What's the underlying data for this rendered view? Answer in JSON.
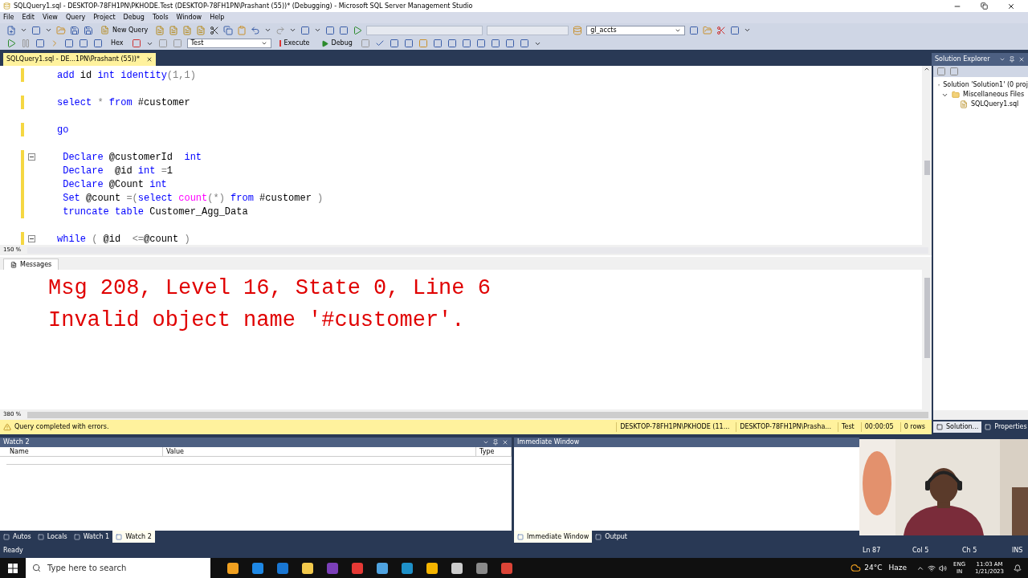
{
  "window": {
    "title": "SQLQuery1.sql - DESKTOP-78FH1PN\\PKHODE.Test (DESKTOP-78FH1PN\\Prashant (55))* (Debugging) - Microsoft SQL Server Management Studio"
  },
  "menu": [
    "File",
    "Edit",
    "View",
    "Query",
    "Project",
    "Debug",
    "Tools",
    "Window",
    "Help"
  ],
  "toolbar1": {
    "new_query": "New Query",
    "database": "gl_accts"
  },
  "toolbar2": {
    "hex": "Hex",
    "connection": "Test",
    "execute": "Execute",
    "debug": "Debug"
  },
  "document_tabs": [
    {
      "title": "SQLQuery1.sql - DE...1PN\\Prashant (55))*",
      "selected": true
    }
  ],
  "editor": {
    "zoom": "150 %",
    "blocks": [
      {
        "fold": false,
        "lines": [
          [
            {
              "kind": "kw",
              "text": "add"
            },
            {
              "kind": "id",
              "text": " id "
            },
            {
              "kind": "kw",
              "text": "int identity"
            },
            {
              "kind": "op",
              "text": "(1,1)"
            }
          ]
        ]
      },
      {
        "fold": false,
        "lines": [
          [
            {
              "kind": "kw",
              "text": "select"
            },
            {
              "kind": "op",
              "text": " * "
            },
            {
              "kind": "kw",
              "text": "from"
            },
            {
              "kind": "id",
              "text": " #customer"
            }
          ]
        ]
      },
      {
        "fold": false,
        "lines": [
          [
            {
              "kind": "kw",
              "text": "go"
            }
          ]
        ]
      },
      {
        "fold": true,
        "lines": [
          [
            {
              "kind": "kw",
              "text": " Declare"
            },
            {
              "kind": "id",
              "text": " @customerId  "
            },
            {
              "kind": "kw",
              "text": "int"
            }
          ],
          [
            {
              "kind": "kw",
              "text": " Declare"
            },
            {
              "kind": "id",
              "text": "  @id "
            },
            {
              "kind": "kw",
              "text": "int"
            },
            {
              "kind": "op",
              "text": " ="
            },
            {
              "kind": "id",
              "text": "1"
            }
          ],
          [
            {
              "kind": "kw",
              "text": " Declare"
            },
            {
              "kind": "id",
              "text": " @Count "
            },
            {
              "kind": "kw",
              "text": "int"
            }
          ],
          [
            {
              "kind": "kw",
              "text": " Set"
            },
            {
              "kind": "id",
              "text": " @count "
            },
            {
              "kind": "op",
              "text": "=("
            },
            {
              "kind": "kw",
              "text": "select "
            },
            {
              "kind": "fn",
              "text": "count"
            },
            {
              "kind": "op",
              "text": "(*)"
            },
            {
              "kind": "kw",
              "text": " from"
            },
            {
              "kind": "id",
              "text": " #customer "
            },
            {
              "kind": "op",
              "text": ")"
            }
          ],
          [
            {
              "kind": "kw",
              "text": " truncate table"
            },
            {
              "kind": "id",
              "text": " Customer_Agg_Data"
            }
          ]
        ]
      },
      {
        "fold": true,
        "lines": [
          [
            {
              "kind": "kw",
              "text": "while"
            },
            {
              "kind": "op",
              "text": " ("
            },
            {
              "kind": "id",
              "text": " @id  "
            },
            {
              "kind": "op",
              "text": "<="
            },
            {
              "kind": "id",
              "text": "@count "
            },
            {
              "kind": "op",
              "text": ")"
            }
          ]
        ]
      }
    ]
  },
  "results": {
    "tab": "Messages",
    "lines": [
      "Msg 208, Level 16, State 0, Line 6",
      "Invalid object name '#customer'."
    ],
    "zoom": "380 %"
  },
  "query_status": {
    "message": "Query completed with errors.",
    "items": [
      "DESKTOP-78FH1PN\\PKHODE (11...",
      "DESKTOP-78FH1PN\\Prasha...",
      "Test",
      "00:00:05",
      "0 rows"
    ]
  },
  "solution_explorer": {
    "title": "Solution Explorer",
    "tree": [
      {
        "label": "Solution 'Solution1' (0 proj",
        "children": [
          {
            "label": "Miscellaneous Files",
            "expanded": true,
            "children": [
              {
                "label": "SQLQuery1.sql"
              }
            ]
          }
        ]
      }
    ],
    "tabs": [
      {
        "label": "Solution...",
        "selected": true
      },
      {
        "label": "Properties",
        "selected": false
      }
    ]
  },
  "watch": {
    "title": "Watch 2",
    "columns": [
      "Name",
      "Value",
      "Type"
    ],
    "tabs": [
      {
        "label": "Autos",
        "selected": false
      },
      {
        "label": "Locals",
        "selected": false
      },
      {
        "label": "Watch 1",
        "selected": false
      },
      {
        "label": "Watch 2",
        "selected": true
      }
    ]
  },
  "immediate": {
    "title": "Immediate Window",
    "tabs": [
      {
        "label": "Immediate Window",
        "selected": true
      },
      {
        "label": "Output",
        "selected": false
      }
    ]
  },
  "status_bar": {
    "text": "Ready",
    "items": [
      "Ln 87",
      "Col 5",
      "Ch 5",
      "INS"
    ]
  },
  "taskbar": {
    "search_placeholder": "Type here to search",
    "weather": "24°C",
    "condition": "Haze",
    "language": [
      "ENG",
      "IN"
    ],
    "time": "11:03 AM",
    "date": "1/21/2023"
  }
}
